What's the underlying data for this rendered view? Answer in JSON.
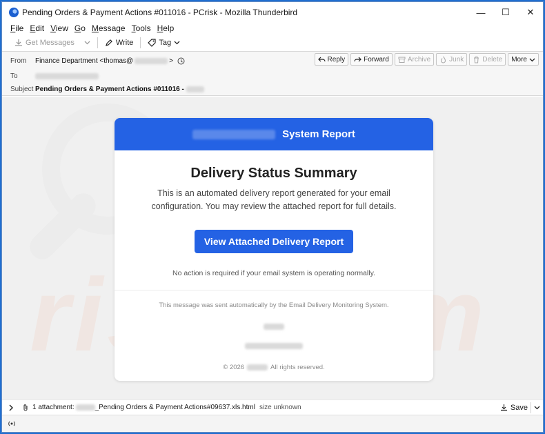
{
  "window": {
    "title": "Pending Orders & Payment Actions #011016 - PCrisk - Mozilla Thunderbird",
    "controls": {
      "minimize": "—",
      "maximize": "☐",
      "close": "✕"
    }
  },
  "menu": [
    "File",
    "Edit",
    "View",
    "Go",
    "Message",
    "Tools",
    "Help"
  ],
  "toolbar": {
    "get_messages": "Get Messages",
    "write": "Write",
    "tag": "Tag"
  },
  "header": {
    "from_label": "From",
    "from_value": "Finance Department <thomas@",
    "from_suffix": ">",
    "to_label": "To",
    "subject_label": "Subject",
    "subject_value": "Pending Orders & Payment Actions #011016 -",
    "actions": {
      "reply": "Reply",
      "forward": "Forward",
      "archive": "Archive",
      "junk": "Junk",
      "delete": "Delete",
      "more": "More"
    }
  },
  "email": {
    "header_title": "System Report",
    "title": "Delivery Status Summary",
    "body": "This is an automated delivery report generated for your email configuration. You may review the attached report for full details.",
    "cta": "View Attached Delivery Report",
    "note": "No action is required if your email system is operating normally.",
    "footer": "This message was sent automatically by the Email Delivery Monitoring System.",
    "copyright_year": "© 2026",
    "copyright_tail": "All rights reserved."
  },
  "attachment": {
    "count": "1 attachment:",
    "name": "_Pending Orders & Payment Actions#09637.xls.html",
    "size": "size unknown",
    "save": "Save"
  },
  "colors": {
    "accent": "#2462e4",
    "window_border": "#1f6fd1"
  }
}
